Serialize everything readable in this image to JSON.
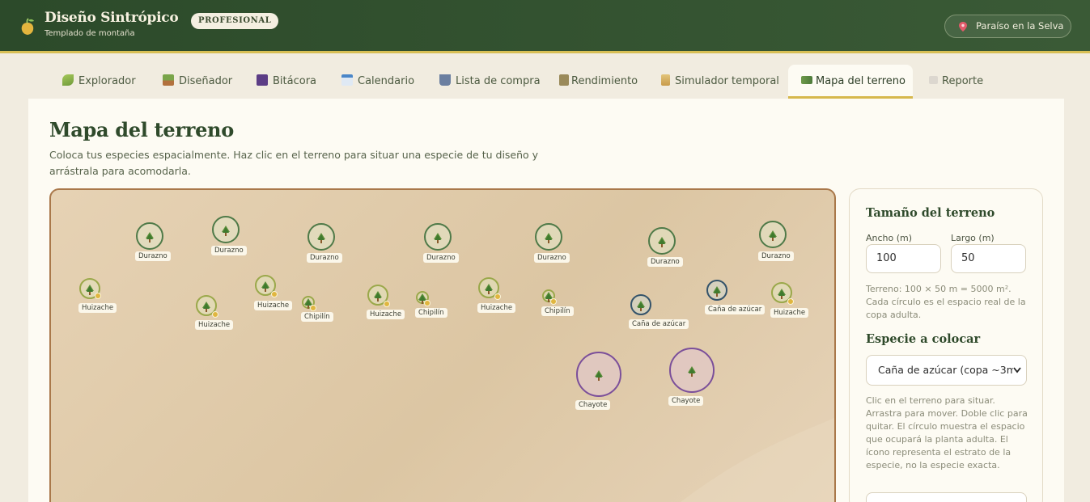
{
  "app": {
    "brand": "Diseño Sintrópico",
    "template": "Templado de montaña",
    "badge": "PROFESIONAL",
    "location": "Paraíso en la Selva"
  },
  "tabs": [
    {
      "label": "Explorador",
      "icon": "sprout-icon"
    },
    {
      "label": "Diseñador",
      "icon": "potted-plant-icon"
    },
    {
      "label": "Bitácora",
      "icon": "notebook-icon"
    },
    {
      "label": "Calendario",
      "icon": "calendar-icon"
    },
    {
      "label": "Lista de compra",
      "icon": "cart-icon"
    },
    {
      "label": "Rendimiento",
      "icon": "scales-icon"
    },
    {
      "label": "Simulador temporal",
      "icon": "hourglass-icon"
    },
    {
      "label": "Mapa del terreno",
      "icon": "map-icon",
      "active": true
    },
    {
      "label": "Reporte",
      "icon": "report-icon"
    }
  ],
  "page": {
    "title": "Mapa del terreno",
    "subtitle": "Coloca tus especies espacialmente. Haz clic en el terreno para situar una especie de tu diseño y arrástrala para acomodarla."
  },
  "plants": [
    {
      "name": "Durazno"
    },
    {
      "name": "Durazno"
    },
    {
      "name": "Durazno"
    },
    {
      "name": "Durazno"
    },
    {
      "name": "Durazno"
    },
    {
      "name": "Durazno"
    },
    {
      "name": "Durazno"
    },
    {
      "name": "Huizache"
    },
    {
      "name": "Huizache"
    },
    {
      "name": "Huizache"
    },
    {
      "name": "Huizache"
    },
    {
      "name": "Huizache"
    },
    {
      "name": "Huizache"
    },
    {
      "name": "Chipilín"
    },
    {
      "name": "Chipilín"
    },
    {
      "name": "Chipilín"
    },
    {
      "name": "Caña de azúcar"
    },
    {
      "name": "Caña de azúcar"
    },
    {
      "name": "Chayote"
    },
    {
      "name": "Chayote"
    }
  ],
  "sidebar": {
    "terrain_title": "Tamaño del terreno",
    "width_label": "Ancho (m)",
    "width_value": "100",
    "length_label": "Largo (m)",
    "length_value": "50",
    "terrain_note": "Terreno: 100 × 50 m = 5000 m². Cada círculo es el espacio real de la copa adulta.",
    "species_title": "Especie a colocar",
    "species_selected": "Caña de azúcar (copa ~3m",
    "help": "Clic en el terreno para situar. Arrastra para mover. Doble clic para quitar. El círculo muestra el espacio que ocupará la planta adulta. El ícono representa el estrato de la especie, no la especie exacta."
  },
  "colors": {
    "header_bg": "#2c4a2a",
    "accent_gold": "#d8bf55",
    "durazno_ring": "#4f7a48",
    "huizache_ring": "#9aa84a",
    "cana_ring": "#34536a",
    "chayote_ring": "#7b4f9a"
  }
}
